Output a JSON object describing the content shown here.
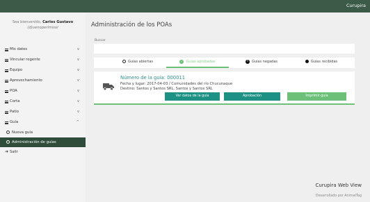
{
  "topbar": {
    "brand": "Curupira"
  },
  "sidebar": {
    "welcome_prefix": "Sea bienvenido,",
    "user_name": "Carlos Gustavo",
    "user_email": "(d)uenoperimisol",
    "items": [
      {
        "label": "Mis datos",
        "chevron": "v"
      },
      {
        "label": "Vincular regente",
        "chevron": "v"
      },
      {
        "label": "Equipo",
        "chevron": "v"
      },
      {
        "label": "Aprovechamiento",
        "chevron": "v"
      },
      {
        "label": "POA",
        "chevron": "v"
      },
      {
        "label": "Corta",
        "chevron": "v"
      },
      {
        "label": "Patio",
        "chevron": "v"
      },
      {
        "label": "Guía",
        "chevron": "^"
      }
    ],
    "subitems": [
      {
        "label": "Nueva guía"
      },
      {
        "label": "Administración de guías"
      }
    ],
    "logout": "Salir"
  },
  "main": {
    "title": "Administración de los POAs",
    "search_label": "Buscar",
    "search_value": "",
    "tabs": [
      {
        "label": "Guías abiertas",
        "icon": "circle-outline-icon"
      },
      {
        "label": "Guías aprobadas",
        "icon": "check-circle-icon"
      },
      {
        "label": "Guías negadas",
        "icon": "exclamation-circle-icon"
      },
      {
        "label": "Guías recibidas",
        "icon": "filled-circle-icon"
      }
    ],
    "active_tab": "Guías aprobadas",
    "card": {
      "title": "Número de la guía: 000011",
      "line1": "Fecha y lugar: 2017-04-03 / Comunidades del río Chucunaque",
      "line2": "Destino: Santos y Santos SRL, Santos y Santos SRL",
      "buttons": [
        "Ver datos de la guía",
        "Aprobación",
        "Imprimir guía"
      ]
    }
  },
  "footer": {
    "brand": "Curupira Web View",
    "developer": "Desarrollado por AnimalTag"
  },
  "colors": {
    "topbar": "#3b5a47",
    "accent_teal": "#1c9184",
    "accent_green": "#6cc077",
    "active_sidebar": "#2f4c3a"
  }
}
